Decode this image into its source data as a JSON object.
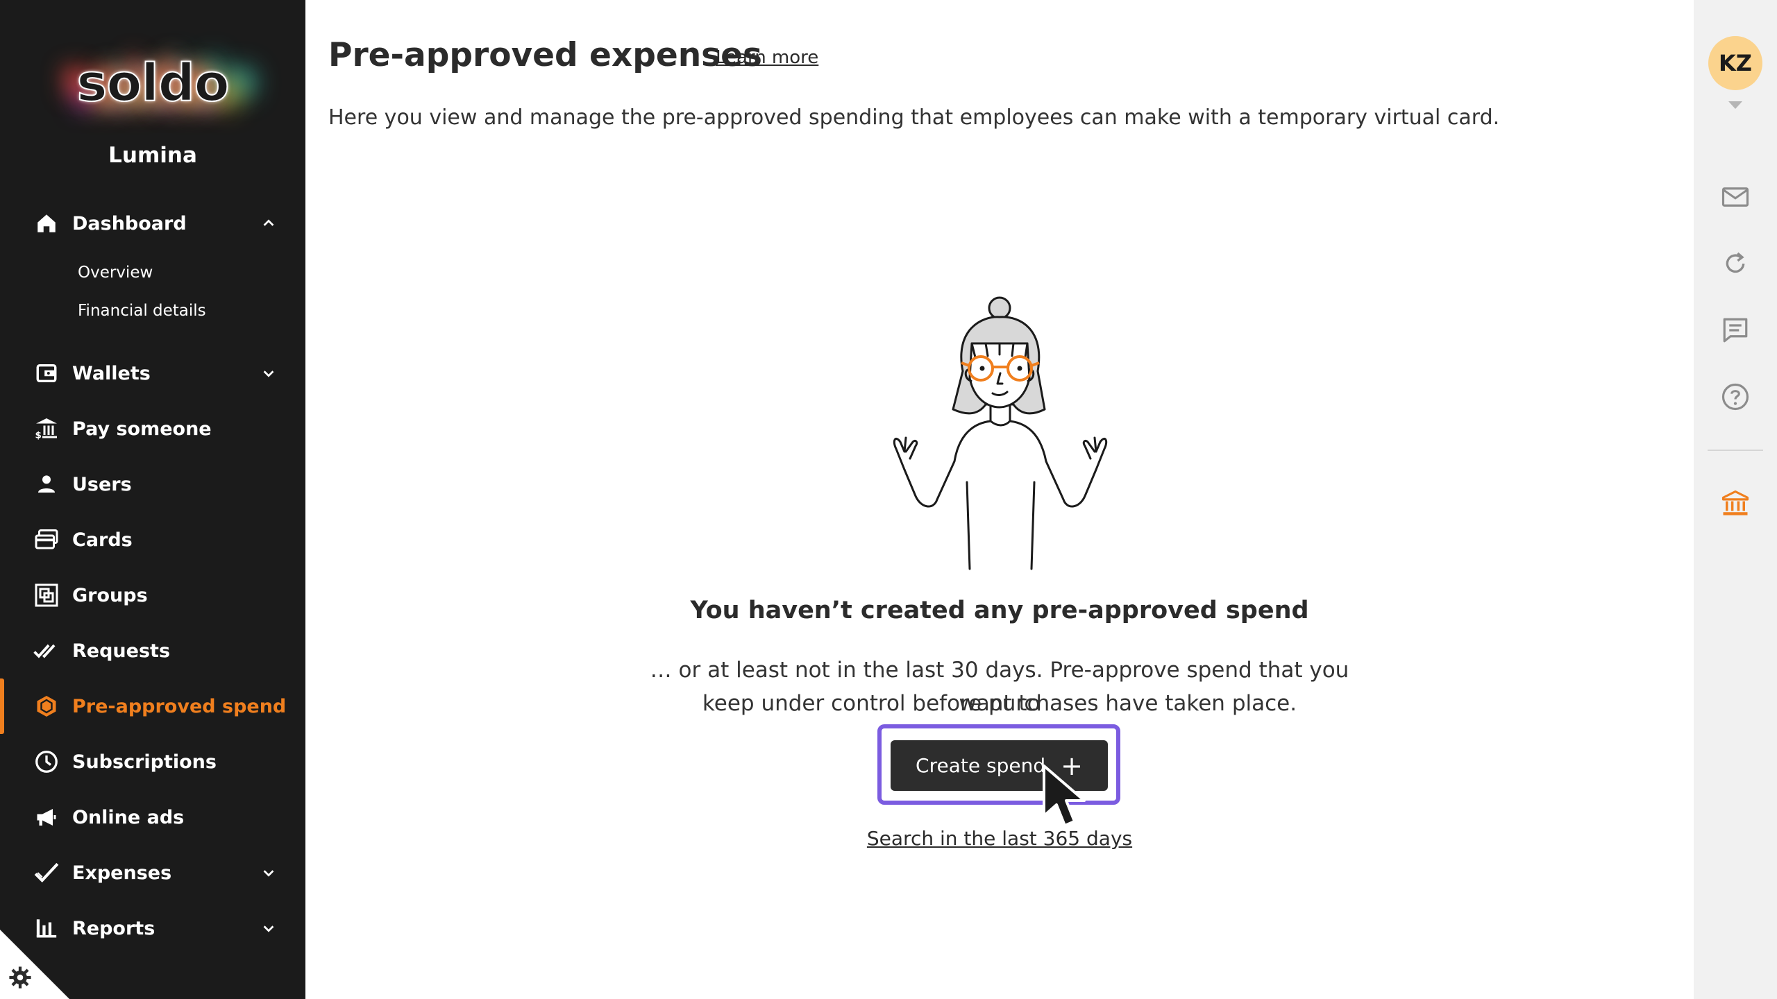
{
  "brand": {
    "logo_text": "soldo",
    "org_name": "Lumina"
  },
  "sidebar": {
    "items": [
      {
        "label": "Dashboard",
        "icon": "home-icon",
        "expanded": true,
        "children": [
          {
            "label": "Overview"
          },
          {
            "label": "Financial details"
          }
        ]
      },
      {
        "label": "Wallets",
        "icon": "wallet-icon",
        "expanded": false
      },
      {
        "label": "Pay someone",
        "icon": "bank-transfer-icon"
      },
      {
        "label": "Users",
        "icon": "user-icon"
      },
      {
        "label": "Cards",
        "icon": "cards-icon"
      },
      {
        "label": "Groups",
        "icon": "groups-icon"
      },
      {
        "label": "Requests",
        "icon": "double-check-icon"
      },
      {
        "label": "Pre-approved spend",
        "icon": "hexagon-icon",
        "active": true
      },
      {
        "label": "Subscriptions",
        "icon": "clock-icon"
      },
      {
        "label": "Online ads",
        "icon": "megaphone-icon"
      },
      {
        "label": "Expenses",
        "icon": "check-icon",
        "expanded": false
      },
      {
        "label": "Reports",
        "icon": "bar-chart-icon",
        "expanded": false
      }
    ],
    "settings_icon": "gear-icon"
  },
  "header": {
    "title": "Pre-approved expenses",
    "learn_more": "Learn more",
    "description": "Here you view and manage the pre-approved spending that employees can make with a temporary virtual card."
  },
  "empty_state": {
    "title": "You haven’t created any pre-approved spend",
    "line1": "… or at least not in the last 30 days. Pre-approve spend that you want to",
    "line2": "keep under control before purchases have taken place.",
    "create_button": "Create spend",
    "search_link": "Search in the last 365 days"
  },
  "rail": {
    "avatar_initials": "KZ",
    "icons": [
      "mail-icon",
      "refresh-icon",
      "chat-icon",
      "help-icon",
      "bank-icon"
    ]
  },
  "colors": {
    "sidebar_bg": "#1b1b1b",
    "accent": "#f07f1e",
    "focus_ring": "#7b5ce0",
    "button_bg": "#2d2d2d",
    "avatar_bg": "#fbd38d"
  }
}
